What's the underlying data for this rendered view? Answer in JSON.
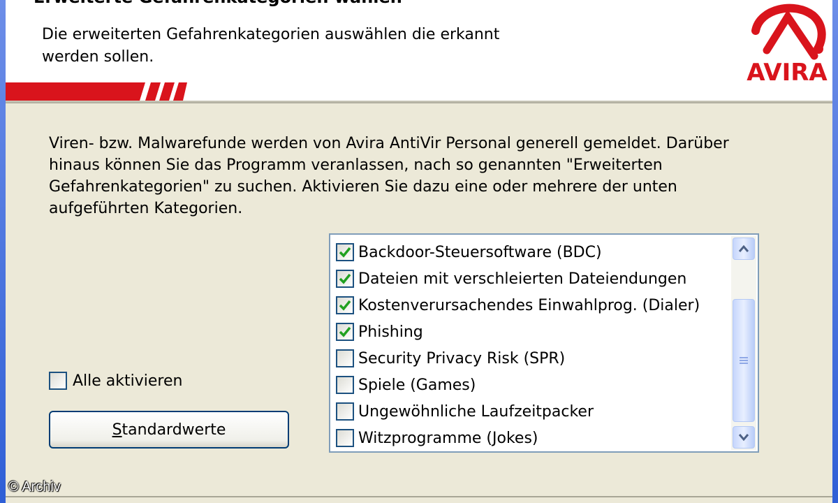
{
  "header": {
    "title": "Erweiterte Gefahrenkategorien wählen",
    "description": "Die erweiterten Gefahrenkategorien auswählen die erkannt\nwerden sollen.",
    "logo_text": "AVIRA",
    "brand_color": "#d9141c"
  },
  "intro_text": "Viren- bzw. Malwarefunde werden von Avira AntiVir Personal generell gemeldet. Darüber\nhinaus können Sie das Programm veranlassen, nach so genannten \"Erweiterten\nGefahrenkategorien\" zu suchen. Aktivieren Sie dazu eine oder mehrere der unten\naufgeführten Kategorien.",
  "select_all": {
    "label": "Alle aktivieren",
    "checked": false
  },
  "defaults_button": {
    "label_accel": "S",
    "label_rest": "tandardwerte"
  },
  "categories": [
    {
      "label": "Backdoor-Steuersoftware (BDC)",
      "checked": true
    },
    {
      "label": "Dateien mit verschleierten Dateiendungen",
      "checked": true
    },
    {
      "label": "Kostenverursachendes Einwahlprog. (Dialer)",
      "checked": true
    },
    {
      "label": "Phishing",
      "checked": true
    },
    {
      "label": "Security Privacy Risk (SPR)",
      "checked": false
    },
    {
      "label": "Spiele (Games)",
      "checked": false
    },
    {
      "label": "Ungewöhnliche Laufzeitpacker",
      "checked": false
    },
    {
      "label": "Witzprogramme (Jokes)",
      "checked": false
    }
  ],
  "watermark": "© Archiv",
  "icons": {
    "check": "checkmark-icon",
    "scroll_up": "chevron-up-icon",
    "scroll_down": "chevron-down-icon",
    "logo": "avira-umbrella-icon"
  }
}
